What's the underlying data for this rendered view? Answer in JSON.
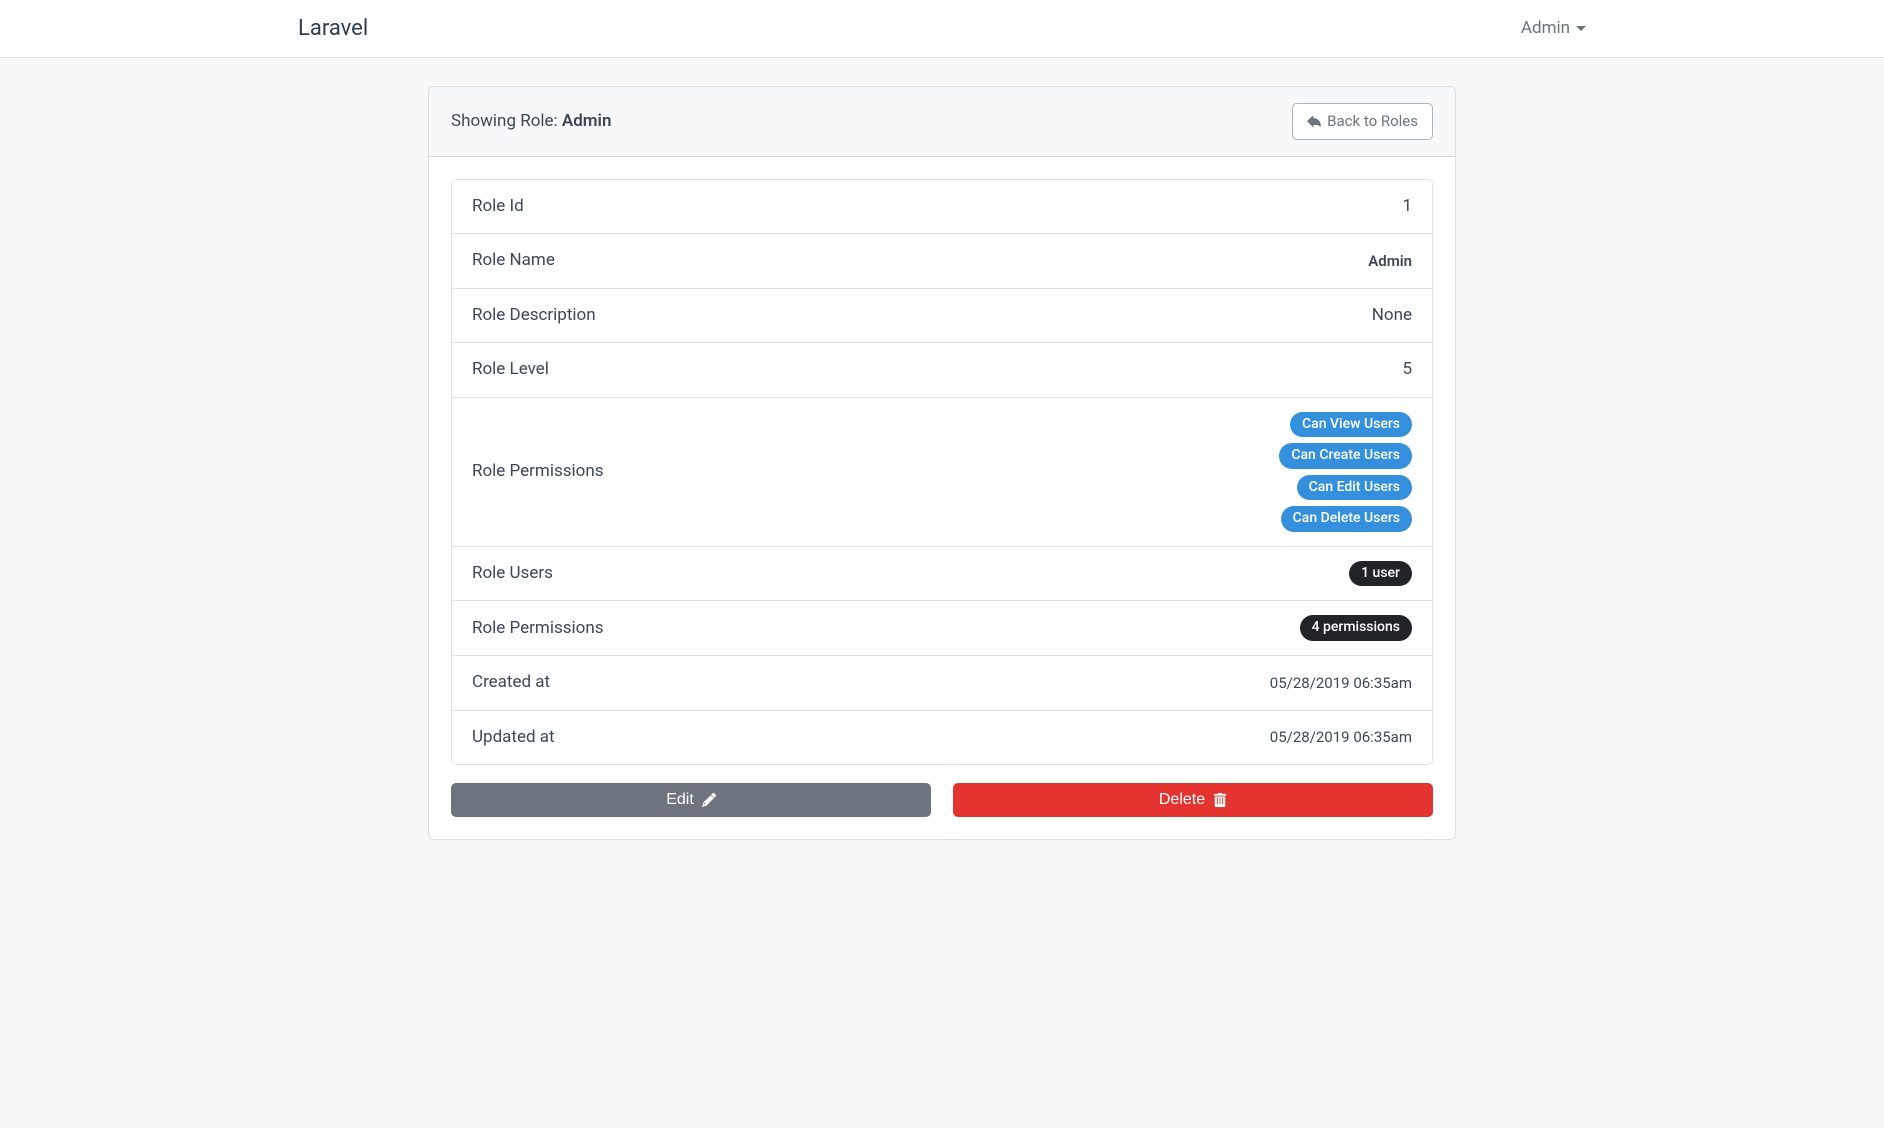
{
  "brand": "Laravel",
  "user_menu": "Admin",
  "header": {
    "showing_prefix": "Showing Role: ",
    "role_name": "Admin",
    "back_button": "Back to Roles"
  },
  "rows": {
    "role_id": {
      "label": "Role Id",
      "value": "1"
    },
    "role_name": {
      "label": "Role Name",
      "value": "Admin"
    },
    "role_description": {
      "label": "Role Description",
      "value": "None"
    },
    "role_level": {
      "label": "Role Level",
      "value": "5"
    },
    "role_permissions_list": {
      "label": "Role Permissions",
      "items": [
        "Can View Users",
        "Can Create Users",
        "Can Edit Users",
        "Can Delete Users"
      ]
    },
    "role_users": {
      "label": "Role Users",
      "badge": "1 user"
    },
    "role_permissions_count": {
      "label": "Role Permissions",
      "badge": "4 permissions"
    },
    "created_at": {
      "label": "Created at",
      "value": "05/28/2019 06:35am"
    },
    "updated_at": {
      "label": "Updated at",
      "value": "05/28/2019 06:35am"
    }
  },
  "actions": {
    "edit": "Edit",
    "delete": "Delete"
  }
}
